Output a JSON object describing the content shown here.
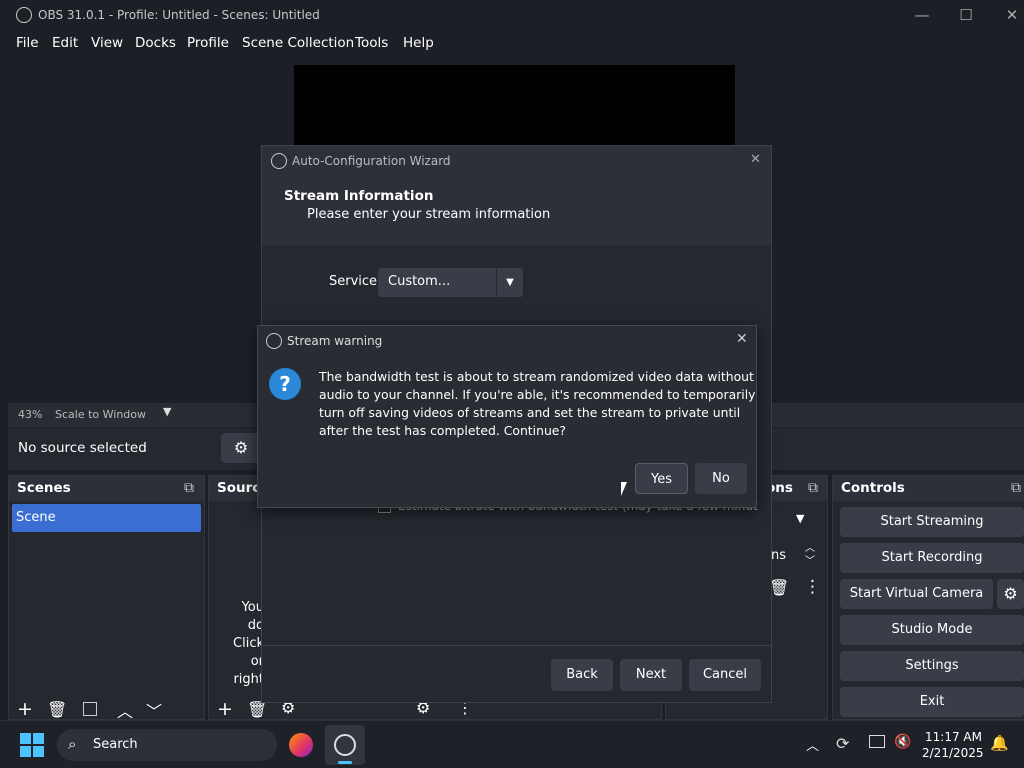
{
  "window": {
    "title": "OBS 31.0.1 - Profile: Untitled - Scenes: Untitled"
  },
  "menu": [
    "File",
    "Edit",
    "View",
    "Docks",
    "Profile",
    "Scene Collection",
    "Tools",
    "Help"
  ],
  "zoom": {
    "percent": "43%",
    "mode": "Scale to Window"
  },
  "source_bar": {
    "text": "No source selected"
  },
  "docks": {
    "scenes": {
      "title": "Scenes",
      "items": [
        "Scene"
      ]
    },
    "sources": {
      "title": "Source",
      "empty_lines": [
        "You do",
        "Click",
        "or right"
      ]
    },
    "transitions": {
      "title": "ons",
      "field": "ns"
    },
    "controls": {
      "title": "Controls",
      "buttons": [
        "Start Streaming",
        "Start Recording",
        "Start Virtual Camera",
        "Studio Mode",
        "Settings",
        "Exit"
      ]
    }
  },
  "wizard": {
    "title": "Auto-Configuration Wizard",
    "heading": "Stream Information",
    "subheading": "Please enter your stream information",
    "service_label": "Service",
    "service_value": "Custom...",
    "checkbox_text": "Estimate bitrate with bandwidth test (may take a few minut",
    "back": "Back",
    "next": "Next",
    "cancel": "Cancel"
  },
  "warning": {
    "title": "Stream warning",
    "lines": [
      "The bandwidth test is about to stream randomized video data without",
      "audio to your channel. If you're able, it's recommended to temporarily",
      "turn off saving videos of streams and set the stream to private until",
      "after the test has completed. Continue?"
    ],
    "yes": "Yes",
    "no": "No"
  },
  "taskbar": {
    "search": "Search",
    "time": "11:17 AM",
    "date": "2/21/2025"
  }
}
